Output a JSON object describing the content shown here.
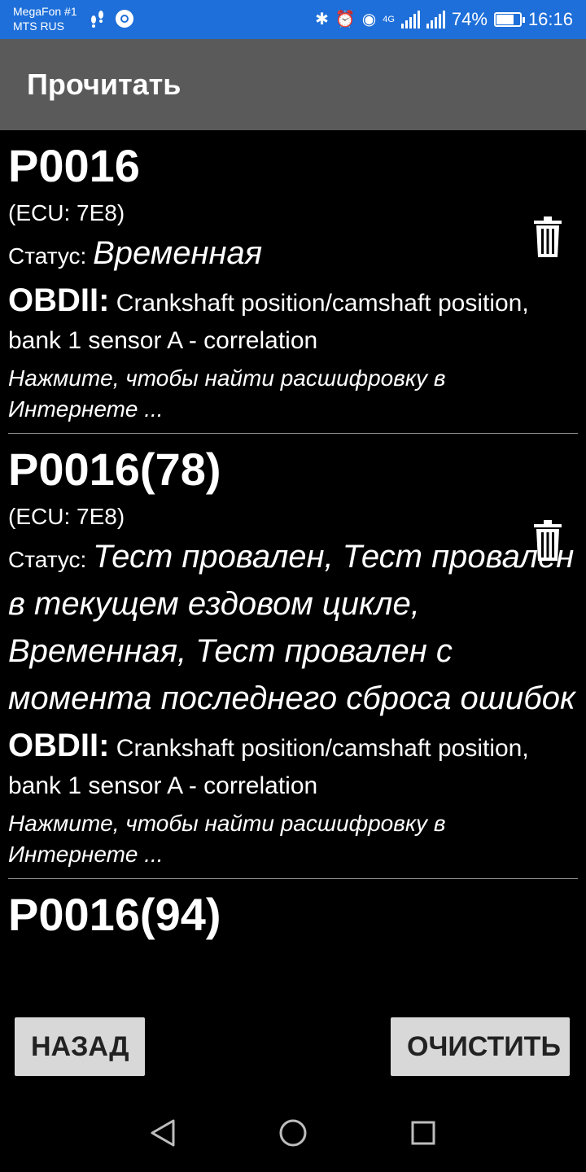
{
  "status_bar": {
    "carrier_line1": "MegaFon #1",
    "carrier_line2": "MTS RUS",
    "battery": "74%",
    "time": "16:16",
    "network": "4G",
    "battery_level": 0.74
  },
  "app_bar": {
    "title": "Прочитать"
  },
  "items": [
    {
      "code": "P0016",
      "ecu": "(ECU: 7E8)",
      "status_label": "Статус:",
      "status_value": "Временная",
      "obd_label": "OBDII:",
      "obd_desc": "Crankshaft position/camshaft position, bank 1 sensor A - correlation",
      "hint": "Нажмите, чтобы найти расшифровку в Интернете ..."
    },
    {
      "code": "P0016(78)",
      "ecu": "(ECU: 7E8)",
      "status_label": "Статус:",
      "status_value": "Тест провален, Тест провален в текущем ездовом цикле, Временная, Тест провален с момента последнего сброса ошибок",
      "obd_label": "OBDII:",
      "obd_desc": "Crankshaft position/camshaft position, bank 1 sensor A - correlation",
      "hint": "Нажмите, чтобы найти расшифровку в Интернете ..."
    },
    {
      "code": "P0016(94)"
    }
  ],
  "buttons": {
    "back": "НАЗАД",
    "clear": "ОЧИСТИТЬ"
  },
  "icons": {
    "delete": "trash-icon",
    "nav_back": "triangle-back-icon",
    "nav_home": "circle-home-icon",
    "nav_recents": "square-recents-icon"
  },
  "colors": {
    "status_bar": "#1e6fd9",
    "app_bar": "#5a5a5a",
    "background": "#000000",
    "button": "#d8d8d8",
    "button_text": "#222222"
  }
}
